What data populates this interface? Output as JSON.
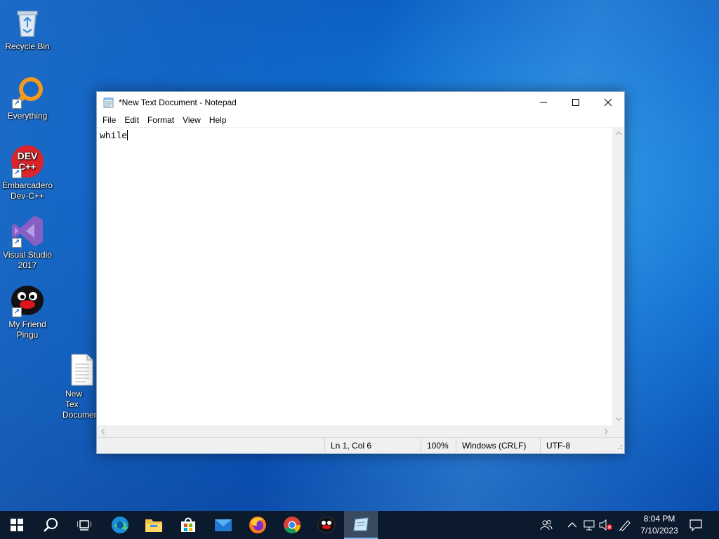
{
  "desktop": {
    "icons": [
      {
        "label": "Recycle Bin",
        "icon": "recycle-bin-icon"
      },
      {
        "label": "Everything",
        "icon": "everything-search-icon"
      },
      {
        "label_line1": "Embarcadero",
        "label_line2": "Dev-C++",
        "badge_line1": "DEV",
        "badge_line2": "C++",
        "icon": "dev-cpp-icon"
      },
      {
        "label_line1": "Visual Studio",
        "label_line2": "2017",
        "icon": "visual-studio-icon"
      },
      {
        "label_line1": "My Friend",
        "label_line2": "Pingu",
        "icon": "pingu-icon"
      },
      {
        "label_line1": "New Tex",
        "label_line2": "Documen",
        "icon": "text-document-icon"
      }
    ]
  },
  "notepad": {
    "title": "*New Text Document - Notepad",
    "menu": [
      "File",
      "Edit",
      "Format",
      "View",
      "Help"
    ],
    "content": "while",
    "status": {
      "position": "Ln 1, Col 6",
      "zoom": "100%",
      "line_ending": "Windows (CRLF)",
      "encoding": "UTF-8"
    }
  },
  "taskbar": {
    "apps": [
      "start-icon",
      "search-icon",
      "task-view-icon",
      "edge-icon",
      "file-explorer-icon",
      "store-icon",
      "mail-icon",
      "firefox-icon",
      "chrome-icon",
      "pingu-icon",
      "notepad-icon"
    ],
    "clock": {
      "time": "8:04 PM",
      "date": "7/10/2023"
    }
  },
  "colors": {
    "taskbar": "#0c1a2e",
    "accent": "#7fb8f0",
    "desktop": "#0f6fd0"
  }
}
